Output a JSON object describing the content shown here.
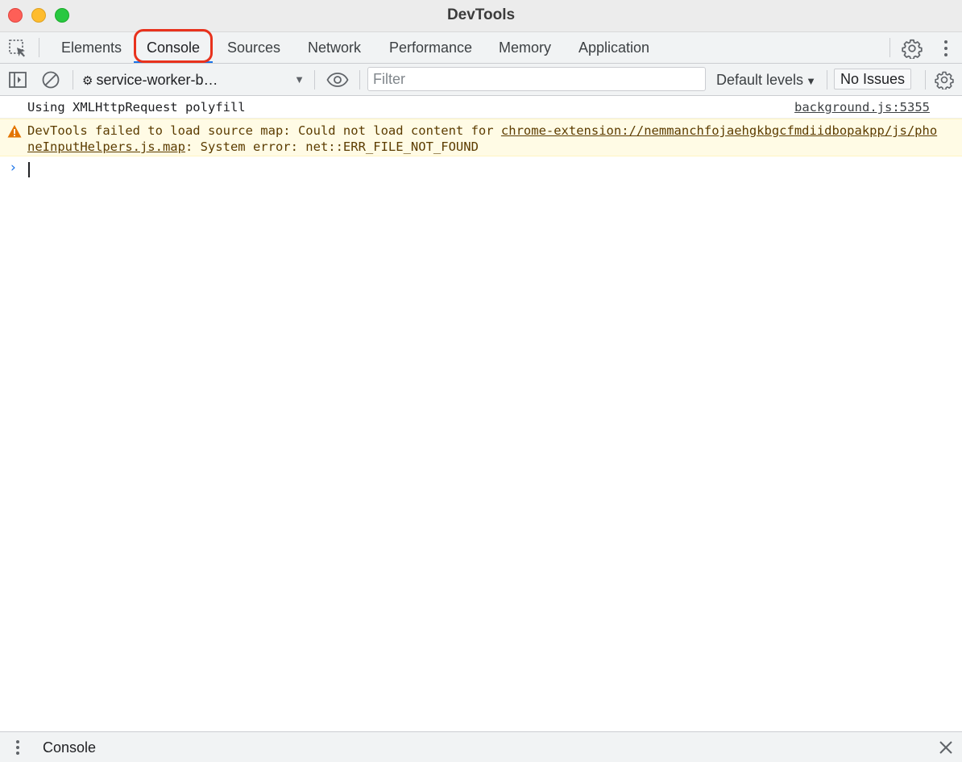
{
  "window": {
    "title": "DevTools"
  },
  "tabs": [
    {
      "label": "Elements"
    },
    {
      "label": "Console"
    },
    {
      "label": "Sources"
    },
    {
      "label": "Network"
    },
    {
      "label": "Performance"
    },
    {
      "label": "Memory"
    },
    {
      "label": "Application"
    }
  ],
  "active_tab": "Console",
  "toolbar": {
    "context": "service-worker-b…",
    "filter_placeholder": "Filter",
    "levels": "Default levels",
    "issues": "No Issues"
  },
  "messages": {
    "log": {
      "text": "Using XMLHttpRequest polyfill",
      "source": "background.js:5355"
    },
    "warning": {
      "prefix": "DevTools failed to load source map: Could not load content for ",
      "link": "chrome-extension://nemmanchfojaehgkbgcfmdiidbopakpp/js/phoneInputHelpers.js.map",
      "suffix": ": System error: net::ERR_FILE_NOT_FOUND"
    }
  },
  "drawer": {
    "tab": "Console"
  },
  "colors": {
    "accent": "#1a73e8",
    "highlight": "#e8321d",
    "warning_bg": "#fffbe5",
    "warning_text": "#5c3c00"
  },
  "icons": {
    "inspect": "inspect-element-icon",
    "settings": "gear-icon",
    "more": "kebab-icon",
    "sidebar": "sidebar-toggle-icon",
    "clear": "clear-console-icon",
    "live_expression": "eye-icon",
    "warning": "warning-triangle-icon",
    "close": "close-icon"
  }
}
